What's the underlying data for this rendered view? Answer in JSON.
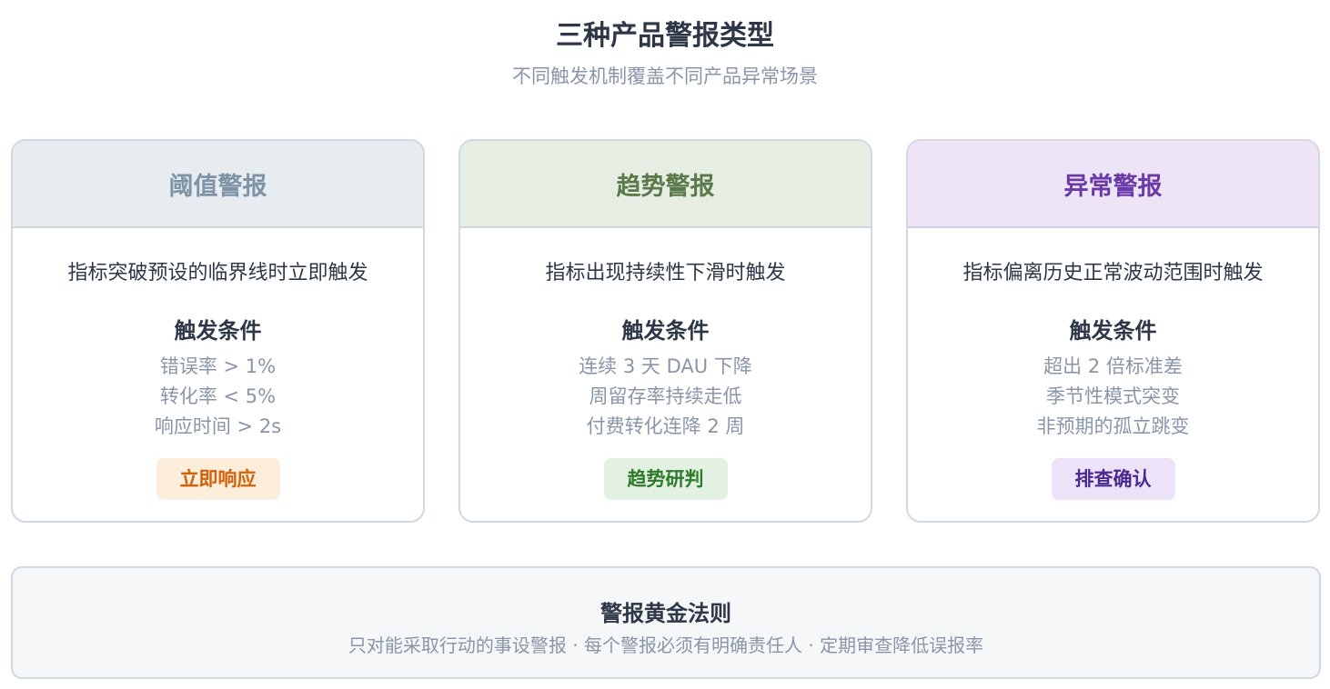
{
  "header": {
    "title": "三种产品警报类型",
    "subtitle": "不同触发机制覆盖不同产品异常场景"
  },
  "cards": [
    {
      "title": "阈值警报",
      "description": "指标突破预设的临界线时立即触发",
      "conditions_title": "触发条件",
      "conditions": [
        "错误率 > 1%",
        "转化率 < 5%",
        "响应时间 > 2s"
      ],
      "badge": "立即响应",
      "accent_color": "#d3610a"
    },
    {
      "title": "趋势警报",
      "description": "指标出现持续性下滑时触发",
      "conditions_title": "触发条件",
      "conditions": [
        "连续 3 天 DAU 下降",
        "周留存率持续走低",
        "付费转化连降 2 周"
      ],
      "badge": "趋势研判",
      "accent_color": "#2f7a2c"
    },
    {
      "title": "异常警报",
      "description": "指标偏离历史正常波动范围时触发",
      "conditions_title": "触发条件",
      "conditions": [
        "超出 2 倍标准差",
        "季节性模式突变",
        "非预期的孤立跳变"
      ],
      "badge": "排查确认",
      "accent_color": "#4a2890"
    }
  ],
  "rules": {
    "title": "警报黄金法则",
    "text": "只对能采取行动的事设警报 · 每个警报必须有明确责任人 · 定期审查降低误报率"
  }
}
